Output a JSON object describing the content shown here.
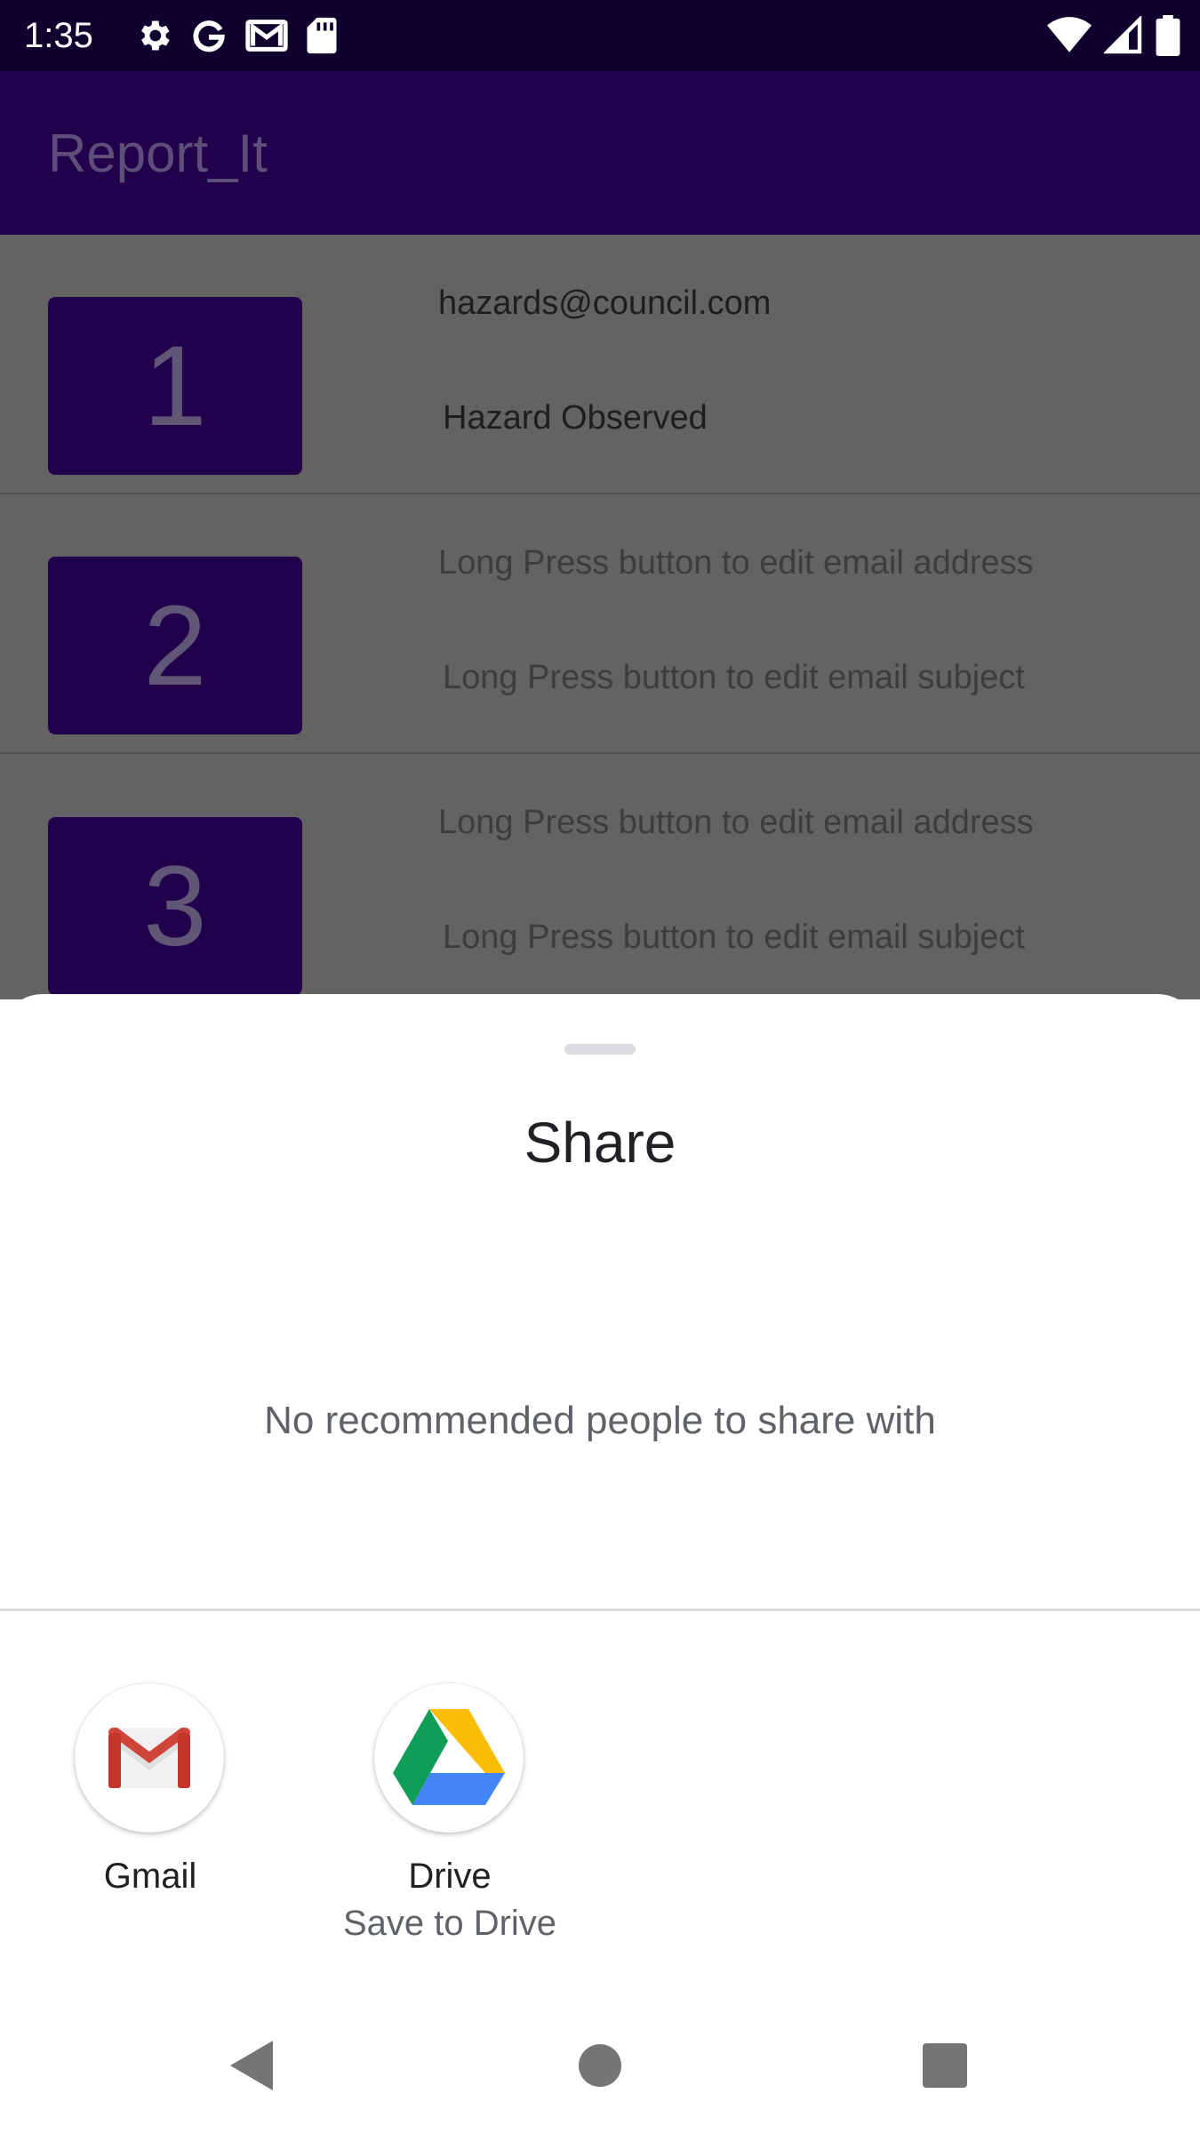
{
  "status_bar": {
    "time": "1:35",
    "left_icons": [
      "settings-icon",
      "google-icon",
      "gmail-icon",
      "sd-card-icon"
    ],
    "right_icons": [
      "wifi-icon",
      "signal-icon",
      "battery-icon"
    ]
  },
  "app_bar": {
    "title": "Report_It"
  },
  "list": {
    "items": [
      {
        "number": "1",
        "email": "hazards@council.com",
        "subject": "Hazard Observed"
      },
      {
        "number": "2",
        "email": "Long Press button to edit email address",
        "subject": "Long Press button to edit email subject"
      },
      {
        "number": "3",
        "email": "Long Press button to edit email address",
        "subject": "Long Press button to edit email subject"
      }
    ]
  },
  "share_sheet": {
    "title": "Share",
    "empty_message": "No recommended people to share with",
    "targets": [
      {
        "label": "Gmail",
        "sublabel": "",
        "icon": "gmail-icon"
      },
      {
        "label": "Drive",
        "sublabel": "Save to Drive",
        "icon": "google-drive-icon"
      }
    ]
  },
  "nav_bar": {
    "buttons": [
      "back-icon",
      "home-icon",
      "recents-icon"
    ]
  },
  "colors": {
    "status_bar": "#10002e",
    "app_bar": "#22004c",
    "button": "#22004c",
    "scrim": "#636363"
  }
}
